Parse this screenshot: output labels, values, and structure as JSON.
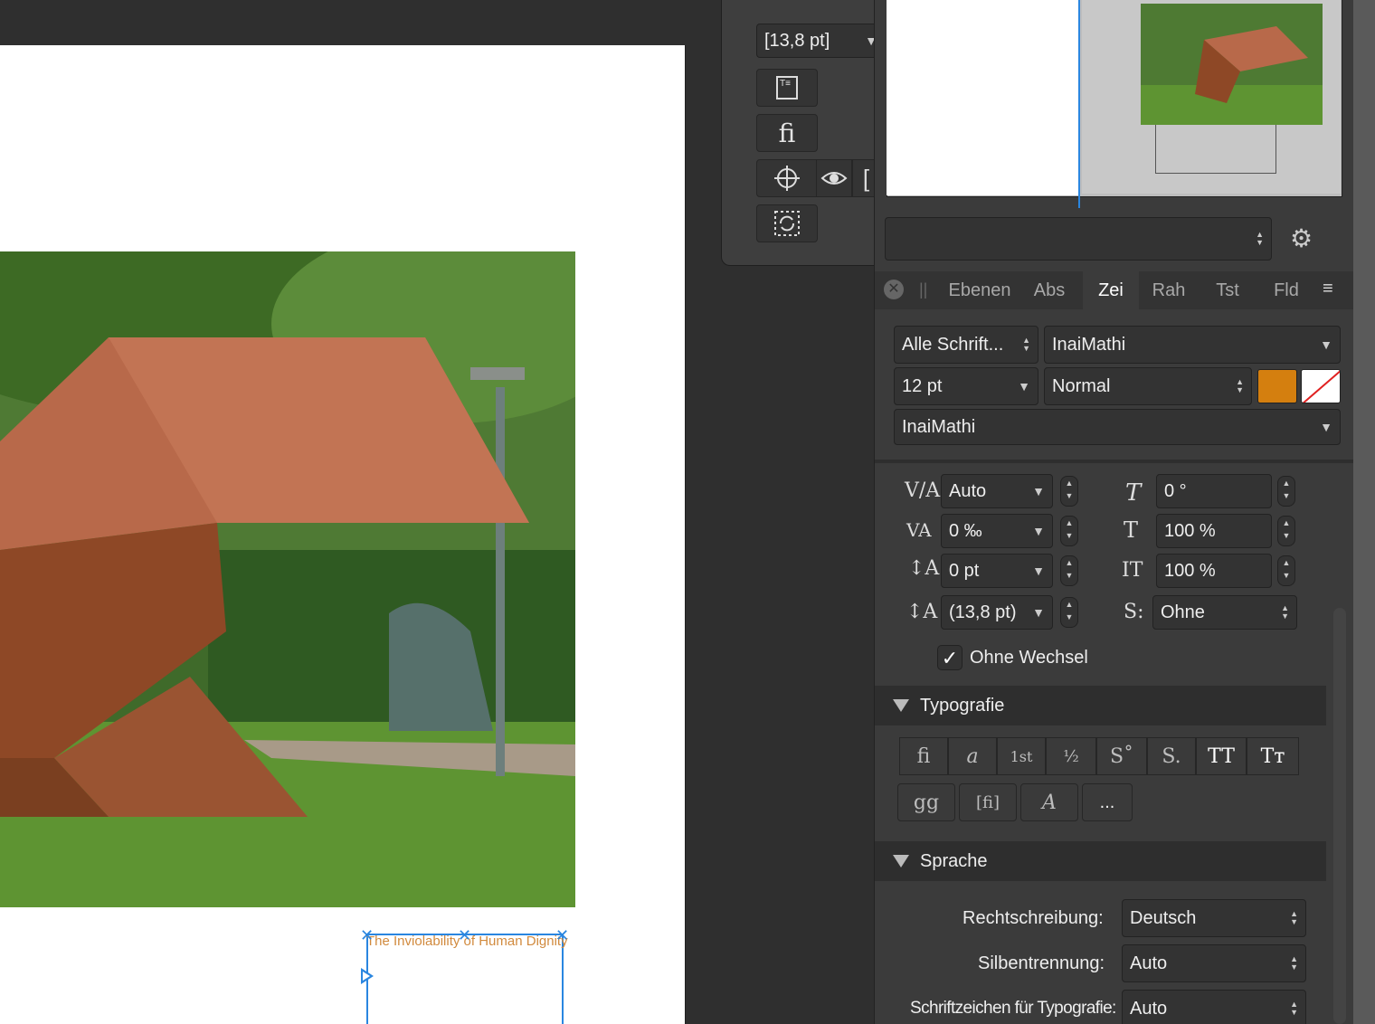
{
  "canvas": {
    "frame_text": "The Inviolability of Human Dignity"
  },
  "toolbar": {
    "leading_value": "[13,8 pt]",
    "ligature_glyph": "fi"
  },
  "panel": {
    "style_value": "",
    "tabs": [
      {
        "label": "Ebenen"
      },
      {
        "label": "Abs"
      },
      {
        "label": "Zei"
      },
      {
        "label": "Rah"
      },
      {
        "label": "Tst"
      },
      {
        "label": "Fld"
      }
    ],
    "font_filter": "Alle Schrift...",
    "font_family": "InaiMathi",
    "font_size": "12 pt",
    "font_style": "Normal",
    "font_family_2": "InaiMathi",
    "text_color": "#d47f0f",
    "kerning": "Auto",
    "tracking": "0 ‰",
    "baseline": "0 pt",
    "leading": "(13,8 pt)",
    "skew": "0 °",
    "horizontal_scale": "100 %",
    "vertical_scale": "100 %",
    "style_s": "Ohne",
    "no_break_label": "Ohne Wechsel",
    "typography_header": "Typografie",
    "typo_more": "...",
    "language_header": "Sprache",
    "spelling_label": "Rechtschreibung:",
    "spelling_value": "Deutsch",
    "hyphenation_label": "Silbentrennung:",
    "hyphenation_value": "Auto",
    "typo_chars_label": "Schriftzeichen für Typografie:",
    "typo_chars_value": "Auto"
  }
}
